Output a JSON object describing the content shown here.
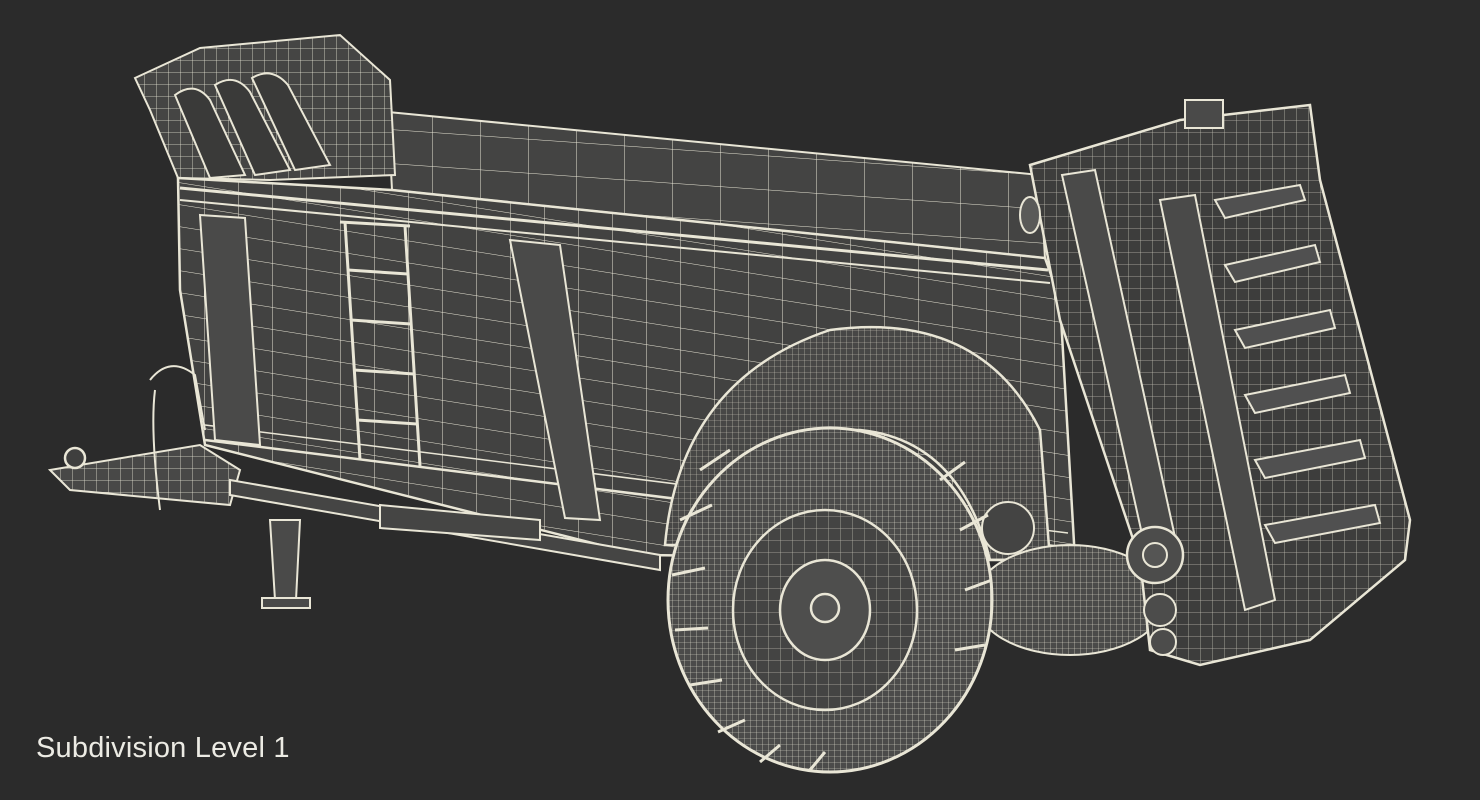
{
  "caption": {
    "text": "Subdivision Level 1"
  },
  "scene": {
    "subject": "manure-spreader-trailer-wireframe",
    "background_color": "#2b2b2b",
    "body_color": "#3f3f3e",
    "wire_color": "#e9e6d6"
  }
}
